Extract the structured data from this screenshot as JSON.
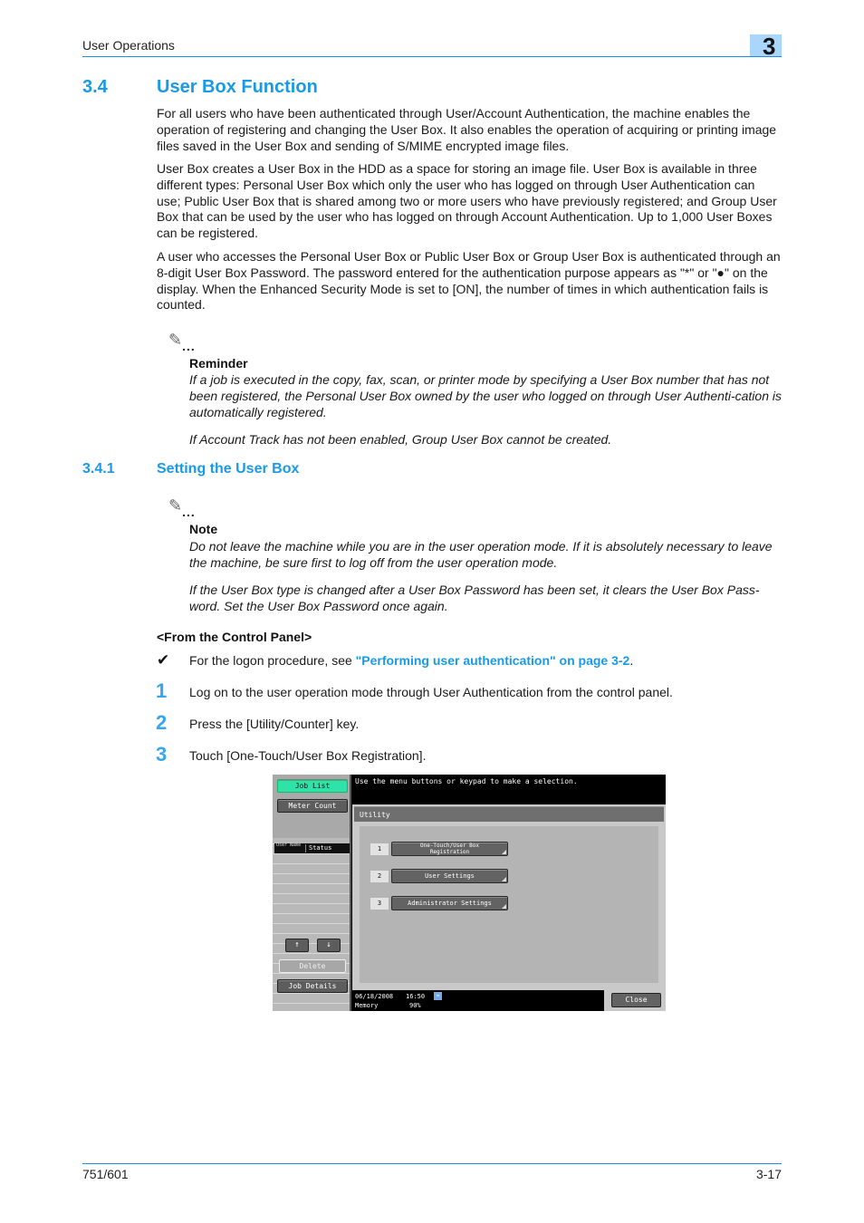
{
  "header": {
    "section": "User Operations",
    "chapter": "3"
  },
  "section": {
    "number": "3.4",
    "title": "User Box Function",
    "paragraphs": [
      "For all users who have been authenticated through User/Account Authentication, the machine enables the operation of registering and changing the User Box. It also enables the operation of acquiring or printing image files saved in the User Box and sending of S/MIME encrypted image files.",
      "User Box creates a User Box in the HDD as a space for storing an image file. User Box is available in three different types: Personal User Box which only the user who has logged on through User Authentication can use; Public User Box that is shared among two or more users who have previously registered; and Group User Box that can be used by the user who has logged on through Account Authentication. Up to 1,000 User Boxes can be registered.",
      "A user who accesses the Personal User Box or Public User Box or Group User Box is authenticated through an 8-digit User Box Password. The password entered for the authentication purpose appears as \"*\" or \"●\" on the display. When the Enhanced Security Mode is set to [ON], the number of times in which authentication fails is counted."
    ],
    "reminder": {
      "icon": "pencil-note-icon",
      "label": "Reminder",
      "texts": [
        "If a job is executed in the copy, fax, scan, or printer mode by specifying a User Box number that has not been registered, the Personal User Box owned by the user who logged on through User Authenti-cation is automatically registered.",
        "If Account Track has not been enabled, Group User Box cannot be created."
      ]
    }
  },
  "subsection": {
    "number": "3.4.1",
    "title": "Setting the User Box",
    "note": {
      "icon": "pencil-note-icon",
      "label": "Note",
      "texts": [
        "Do not leave the machine while you are in the user operation mode. If it is absolutely necessary to leave the machine, be sure first to log off from the user operation mode.",
        "If the User Box type is changed after a User Box Password has been set, it clears the User Box Pass-word. Set the User Box Password once again."
      ]
    },
    "procedure_heading": "<From the Control Panel>",
    "prerequisite": {
      "icon": "checkmark-icon",
      "text_before": "For the logon procedure, see ",
      "link_text": "\"Performing user authentication\" on page 3-2",
      "text_after": "."
    },
    "steps": [
      {
        "number": "1",
        "text": "Log on to the user operation mode through User Authentication from the control panel."
      },
      {
        "number": "2",
        "text": "Press the [Utility/Counter] key."
      },
      {
        "number": "3",
        "text": "Touch [One-Touch/User Box Registration]."
      }
    ]
  },
  "device_screen": {
    "message": "Use the menu buttons or keypad to make a selection.",
    "left_panel": {
      "job_list": "Job List",
      "meter_count": "Meter Count",
      "col_user": "User Name",
      "col_status": "Status",
      "up_arrow": "↑",
      "down_arrow": "↓",
      "delete": "Delete",
      "job_details": "Job Details"
    },
    "panel_title": "Utility",
    "menu": [
      {
        "num": "1",
        "label_line1": "One-Touch/User Box",
        "label_line2": "Registration"
      },
      {
        "num": "2",
        "label": "User Settings"
      },
      {
        "num": "3",
        "label": "Administrator Settings"
      }
    ],
    "status_bar": {
      "date": "06/18/2008",
      "time": "16:50",
      "memory_label": "Memory",
      "memory_value": "90%"
    },
    "close": "Close",
    "colors": {
      "job_list_active": "#2fe3a8"
    }
  },
  "footer": {
    "model": "751/601",
    "page": "3-17"
  }
}
